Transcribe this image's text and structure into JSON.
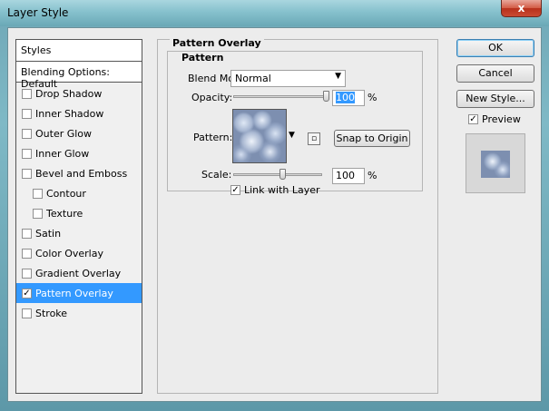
{
  "window": {
    "title": "Layer Style",
    "close_glyph": "x"
  },
  "styles_panel": {
    "header": "Styles",
    "blending_options": "Blending Options: Default",
    "items": [
      {
        "label": "Drop Shadow",
        "checked": false,
        "sub": false
      },
      {
        "label": "Inner Shadow",
        "checked": false,
        "sub": false
      },
      {
        "label": "Outer Glow",
        "checked": false,
        "sub": false
      },
      {
        "label": "Inner Glow",
        "checked": false,
        "sub": false
      },
      {
        "label": "Bevel and Emboss",
        "checked": false,
        "sub": false
      },
      {
        "label": "Contour",
        "checked": false,
        "sub": true
      },
      {
        "label": "Texture",
        "checked": false,
        "sub": true
      },
      {
        "label": "Satin",
        "checked": false,
        "sub": false
      },
      {
        "label": "Color Overlay",
        "checked": false,
        "sub": false
      },
      {
        "label": "Gradient Overlay",
        "checked": false,
        "sub": false
      },
      {
        "label": "Pattern Overlay",
        "checked": true,
        "sub": false,
        "selected": true
      },
      {
        "label": "Stroke",
        "checked": false,
        "sub": false
      }
    ]
  },
  "pattern_overlay": {
    "group_title": "Pattern Overlay",
    "subgroup_title": "Pattern",
    "blend_mode_label": "Blend Mode:",
    "blend_mode_value": "Normal",
    "opacity_label": "Opacity:",
    "opacity_value": "100",
    "opacity_unit": "%",
    "opacity_level": 1.0,
    "pattern_label": "Pattern:",
    "snap_button": "Snap to Origin",
    "scale_label": "Scale:",
    "scale_value": "100",
    "scale_unit": "%",
    "scale_level": 0.5,
    "link_label": "Link with Layer",
    "link_checked": true
  },
  "buttons": {
    "ok": "OK",
    "cancel": "Cancel",
    "new_style": "New Style...",
    "preview_label": "Preview",
    "preview_checked": true
  },
  "colors": {
    "selection": "#3399ff",
    "window_frame": "#7fb9c6"
  }
}
